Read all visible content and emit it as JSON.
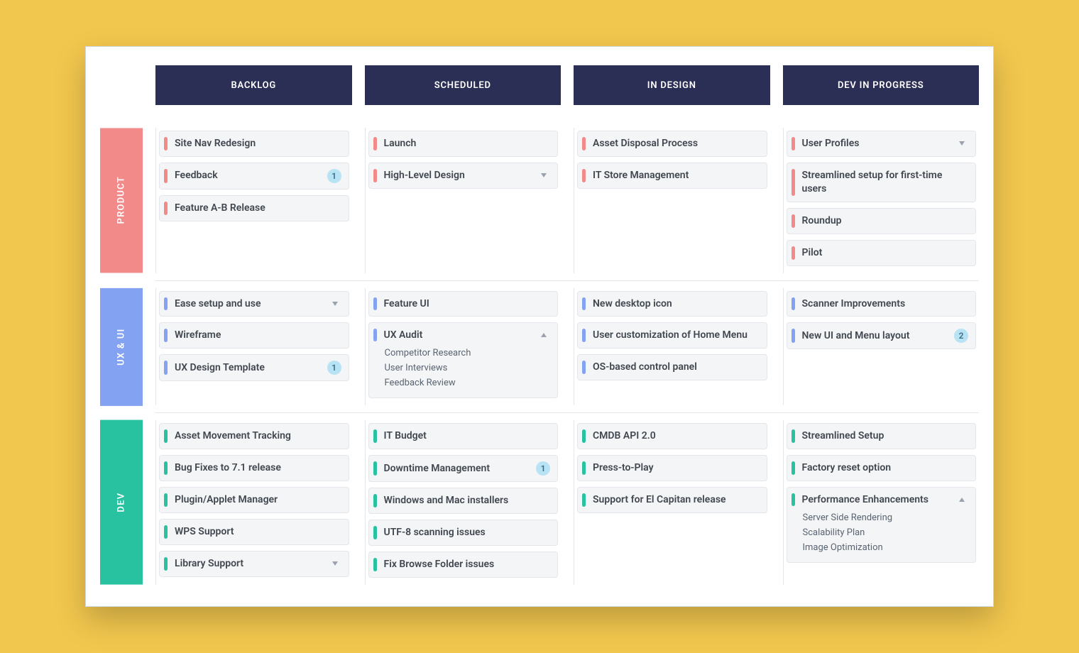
{
  "columns": [
    "BACKLOG",
    "SCHEDULED",
    "IN DESIGN",
    "DEV IN PROGRESS"
  ],
  "lanes": [
    {
      "id": "product",
      "label": "PRODUCT",
      "color": "#f28a8a",
      "cells": {
        "backlog": [
          {
            "title": "Site Nav Redesign"
          },
          {
            "title": "Feedback",
            "badge": "1"
          },
          {
            "title": "Feature A-B Release"
          }
        ],
        "scheduled": [
          {
            "title": "Launch"
          },
          {
            "title": "High-Level Design",
            "toggle": "down"
          }
        ],
        "in_design": [
          {
            "title": "Asset Disposal Process"
          },
          {
            "title": "IT Store Management"
          }
        ],
        "dev_in_progress": [
          {
            "title": "User Profiles",
            "toggle": "down"
          },
          {
            "title": "Streamlined setup for first-time users"
          },
          {
            "title": "Roundup"
          },
          {
            "title": "Pilot"
          }
        ]
      }
    },
    {
      "id": "uxui",
      "label": "UX & UI",
      "color": "#84a2f2",
      "cells": {
        "backlog": [
          {
            "title": "Ease setup and use",
            "toggle": "down"
          },
          {
            "title": "Wireframe"
          },
          {
            "title": "UX Design Template",
            "badge": "1"
          }
        ],
        "scheduled": [
          {
            "title": "Feature UI"
          },
          {
            "title": "UX Audit",
            "toggle": "up",
            "sub": [
              "Competitor Research",
              "User Interviews",
              "Feedback Review"
            ]
          }
        ],
        "in_design": [
          {
            "title": "New desktop icon"
          },
          {
            "title": "User customization of Home Menu"
          },
          {
            "title": "OS-based control panel"
          }
        ],
        "dev_in_progress": [
          {
            "title": "Scanner Improvements"
          },
          {
            "title": "New UI and Menu layout",
            "badge": "2"
          }
        ]
      }
    },
    {
      "id": "dev",
      "label": "DEV",
      "color": "#28c2a0",
      "cells": {
        "backlog": [
          {
            "title": "Asset Movement Tracking"
          },
          {
            "title": "Bug Fixes to 7.1 release"
          },
          {
            "title": "Plugin/Applet Manager"
          },
          {
            "title": "WPS Support"
          },
          {
            "title": "Library Support",
            "toggle": "down"
          }
        ],
        "scheduled": [
          {
            "title": "IT Budget"
          },
          {
            "title": "Downtime Management",
            "badge": "1"
          },
          {
            "title": "Windows and Mac installers"
          },
          {
            "title": "UTF-8 scanning issues"
          },
          {
            "title": "Fix Browse Folder issues"
          }
        ],
        "in_design": [
          {
            "title": "CMDB API 2.0"
          },
          {
            "title": "Press-to-Play"
          },
          {
            "title": "Support for El Capitan release"
          }
        ],
        "dev_in_progress": [
          {
            "title": "Streamlined Setup"
          },
          {
            "title": "Factory reset option"
          },
          {
            "title": "Performance Enhancements",
            "toggle": "up",
            "sub": [
              "Server Side Rendering",
              "Scalability Plan",
              "Image Optimization"
            ]
          }
        ]
      }
    }
  ]
}
